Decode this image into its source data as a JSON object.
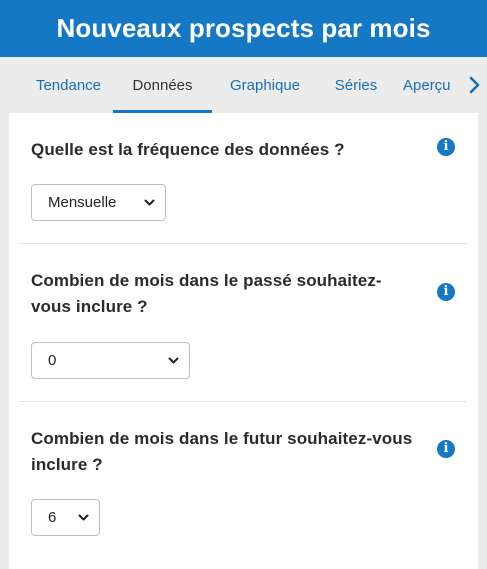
{
  "header": {
    "title": "Nouveaux prospects par mois"
  },
  "tabs": [
    {
      "label": "Tendance",
      "active": false
    },
    {
      "label": "Données",
      "active": true
    },
    {
      "label": "Graphique",
      "active": false
    },
    {
      "label": "Séries",
      "active": false
    },
    {
      "label": "Aperçu",
      "active": false
    }
  ],
  "sections": [
    {
      "question": "Quelle est la fréquence des données ?",
      "selected": "Mensuelle",
      "info_icon": "info-icon"
    },
    {
      "question": "Combien de mois dans le passé souhaitez-vous inclure ?",
      "selected": "0",
      "info_icon": "info-icon"
    },
    {
      "question": "Combien de mois dans le futur souhaitez-vous inclure ?",
      "selected": "6",
      "info_icon": "info-icon"
    }
  ],
  "colors": {
    "accent": "#1478c4",
    "tab_text": "#1a6fb5",
    "background": "#ececec"
  },
  "icons": {
    "tab_next": "chevron-right-icon",
    "select_arrow": "chevron-down-icon",
    "info": "info-icon"
  }
}
